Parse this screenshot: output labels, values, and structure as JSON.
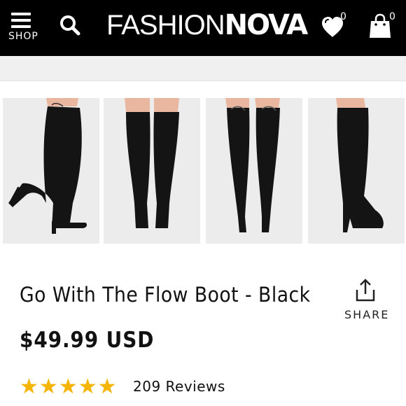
{
  "header": {
    "menu_label": "SHOP",
    "logo_light": "FASHION",
    "logo_bold": "NOVA",
    "wishlist_count": "0",
    "bag_count": "0",
    "icons": [
      "menu-icon",
      "search-icon",
      "heart-icon",
      "shopping-bag-icon"
    ]
  },
  "gallery": {
    "thumbnails": [
      "side-view",
      "front-view",
      "back-view",
      "side-view-right"
    ]
  },
  "product": {
    "title": "Go With The Flow Boot - Black",
    "price": "$49.99 USD",
    "rating": 5,
    "reviews": "209 Reviews",
    "share_label": "SHARE"
  },
  "colors": {
    "header_bg": "#000000",
    "star": "#f4b400",
    "thumb_bg": "#ececec"
  }
}
